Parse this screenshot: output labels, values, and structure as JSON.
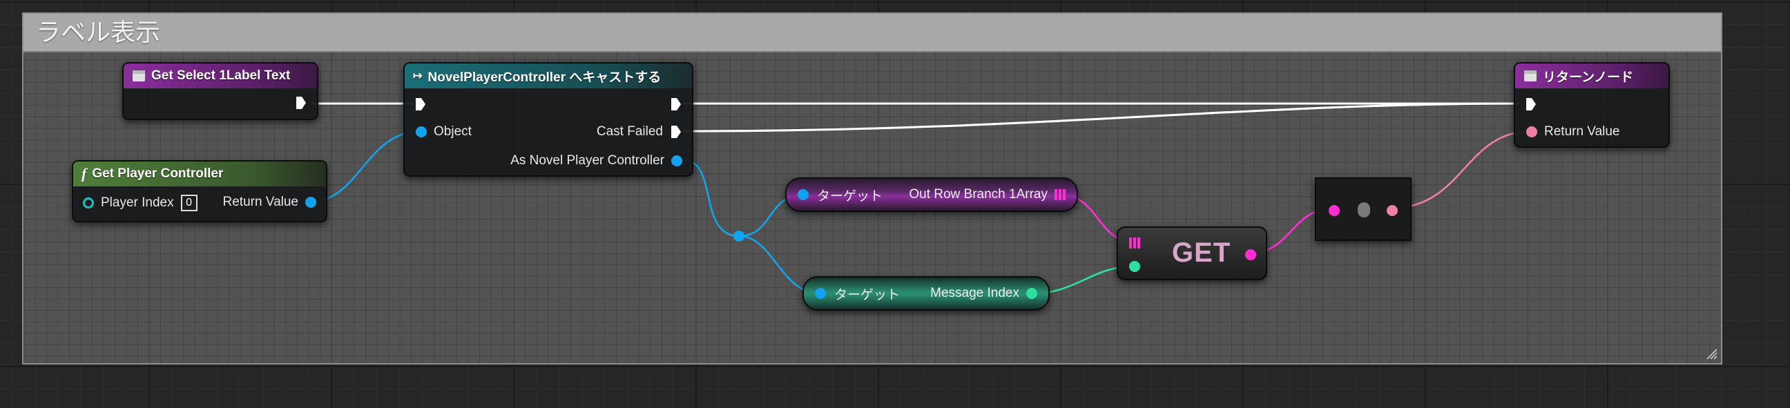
{
  "comment": {
    "title": "ラベル表示"
  },
  "nodes": {
    "get_select": {
      "title": "Get Select 1Label Text"
    },
    "cast": {
      "title": "NovelPlayerController へキャストする",
      "object_label": "Object",
      "cast_failed_label": "Cast Failed",
      "as_label": "As Novel Player Controller"
    },
    "get_player_controller": {
      "title": "Get Player Controller",
      "player_index_label": "Player Index",
      "player_index_value": "0",
      "return_value_label": "Return Value",
      "func_symbol": "f"
    },
    "out_row": {
      "target_label": "ターゲット",
      "output_label": "Out Row Branch 1Array"
    },
    "message_index": {
      "target_label": "ターゲット",
      "output_label": "Message Index"
    },
    "get": {
      "label": "GET"
    },
    "return_node": {
      "title": "リターンノード",
      "return_value_label": "Return Value"
    }
  },
  "colors": {
    "exec": "#ffffff",
    "object_pin": "#12a3ef",
    "int_pin": "#2ee0a0",
    "array_pin": "#ff2ed3",
    "text_pin": "#f07fa4",
    "comment_header": "#a9a9a9"
  }
}
